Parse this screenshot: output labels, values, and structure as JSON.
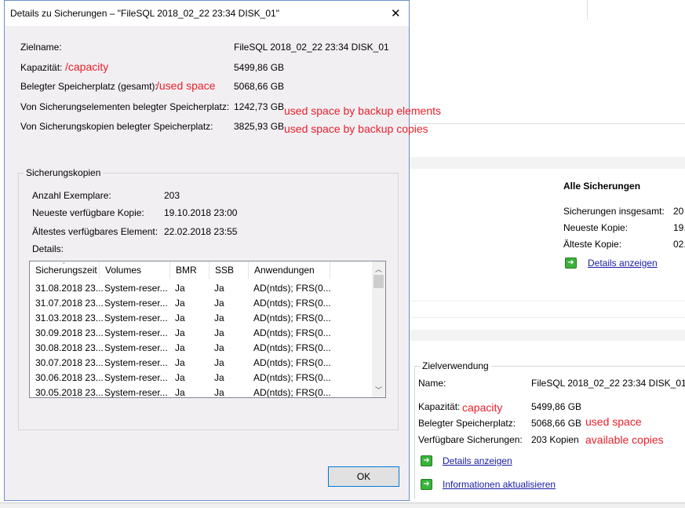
{
  "dialog": {
    "title": "Details zu Sicherungen – \"FileSQL 2018_02_22 23:34 DISK_01\"",
    "close": "✕",
    "fields": [
      {
        "label": "Zielname:",
        "value": "FileSQL 2018_02_22 23:34 DISK_01",
        "note": ""
      },
      {
        "label": "Kapazität:",
        "value": "5499,86 GB",
        "note": "/capacity"
      },
      {
        "label": "Belegter Speicherplatz (gesamt):",
        "value": "5068,66 GB",
        "note": "/used space"
      },
      {
        "label": "Von Sicherungselementen belegter Speicherplatz:",
        "value": "1242,73 GB",
        "note": "used space by backup elements"
      },
      {
        "label": "Von Sicherungskopien belegter Speicherplatz:",
        "value": "3825,93 GB",
        "note": "used space by backup copies"
      }
    ],
    "group": {
      "title": "Sicherungskopien",
      "fields": [
        {
          "label": "Anzahl Exemplare:",
          "value": "203"
        },
        {
          "label": "Neueste verfügbare Kopie:",
          "value": "19.10.2018 23:00"
        },
        {
          "label": "Ältestes verfügbares Element:",
          "value": "22.02.2018 23:55"
        }
      ],
      "details_label": "Details:",
      "columns": [
        "Sicherungszeit",
        "Volumes",
        "BMR",
        "SSB",
        "Anwendungen"
      ],
      "rows": [
        [
          "31.08.2018 23...",
          "System-reser...",
          "Ja",
          "Ja",
          "AD(ntds); FRS(0..."
        ],
        [
          "31.07.2018 23...",
          "System-reser...",
          "Ja",
          "Ja",
          "AD(ntds); FRS(0..."
        ],
        [
          "31.03.2018 23...",
          "System-reser...",
          "Ja",
          "Ja",
          "AD(ntds); FRS(0..."
        ],
        [
          "30.09.2018 23...",
          "System-reser...",
          "Ja",
          "Ja",
          "AD(ntds); FRS(0..."
        ],
        [
          "30.08.2018 23...",
          "System-reser...",
          "Ja",
          "Ja",
          "AD(ntds); FRS(0..."
        ],
        [
          "30.07.2018 23...",
          "System-reser...",
          "Ja",
          "Ja",
          "AD(ntds); FRS(0..."
        ],
        [
          "30.06.2018 23...",
          "System-reser...",
          "Ja",
          "Ja",
          "AD(ntds); FRS(0..."
        ],
        [
          "30.05.2018 23...",
          "System-reser...",
          "Ja",
          "Ja",
          "AD(ntds); FRS(0..."
        ]
      ]
    },
    "ok": "OK"
  },
  "background": {
    "all": {
      "title": "Alle Sicherungen",
      "fields": [
        {
          "label": "Sicherungen insgesamt:",
          "value": "20"
        },
        {
          "label": "Neueste Kopie:",
          "value": "19."
        },
        {
          "label": "Älteste Kopie:",
          "value": "02."
        }
      ],
      "link": "Details anzeigen"
    },
    "target": {
      "title": "Zielverwendung",
      "fields": [
        {
          "label": "Name:",
          "value": "FileSQL 2018_02_22 23:34 DISK_01",
          "note": ""
        },
        {
          "label": "Kapazität:",
          "value": "5499,86 GB",
          "note": "capacity"
        },
        {
          "label": "Belegter Speicherplatz:",
          "value": "5068,66 GB",
          "note": "used space"
        },
        {
          "label": "Verfügbare Sicherungen:",
          "value": "203 Kopien",
          "note": "available copies"
        }
      ],
      "links": [
        "Details anzeigen",
        "Informationen aktualisieren"
      ]
    }
  }
}
